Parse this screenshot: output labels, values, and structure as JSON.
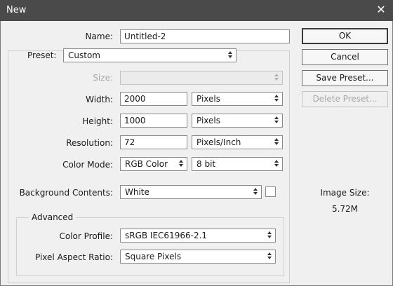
{
  "window": {
    "title": "New"
  },
  "name": {
    "label": "Name:",
    "value": "Untitled-2"
  },
  "preset": {
    "label": "Preset:",
    "value": "Custom"
  },
  "size": {
    "label": "Size:",
    "value": ""
  },
  "width": {
    "label": "Width:",
    "value": "2000",
    "unit": "Pixels"
  },
  "height": {
    "label": "Height:",
    "value": "1000",
    "unit": "Pixels"
  },
  "resolution": {
    "label": "Resolution:",
    "value": "72",
    "unit": "Pixels/Inch"
  },
  "color_mode": {
    "label": "Color Mode:",
    "value": "RGB Color",
    "depth": "8 bit"
  },
  "background": {
    "label": "Background Contents:",
    "value": "White"
  },
  "advanced": {
    "caption": "Advanced",
    "color_profile": {
      "label": "Color Profile:",
      "value": "sRGB IEC61966-2.1"
    },
    "pixel_aspect": {
      "label": "Pixel Aspect Ratio:",
      "value": "Square Pixels"
    }
  },
  "buttons": {
    "ok": "OK",
    "cancel": "Cancel",
    "save_preset": "Save Preset...",
    "delete_preset": "Delete Preset..."
  },
  "image_size": {
    "label": "Image Size:",
    "value": "5.72M"
  }
}
